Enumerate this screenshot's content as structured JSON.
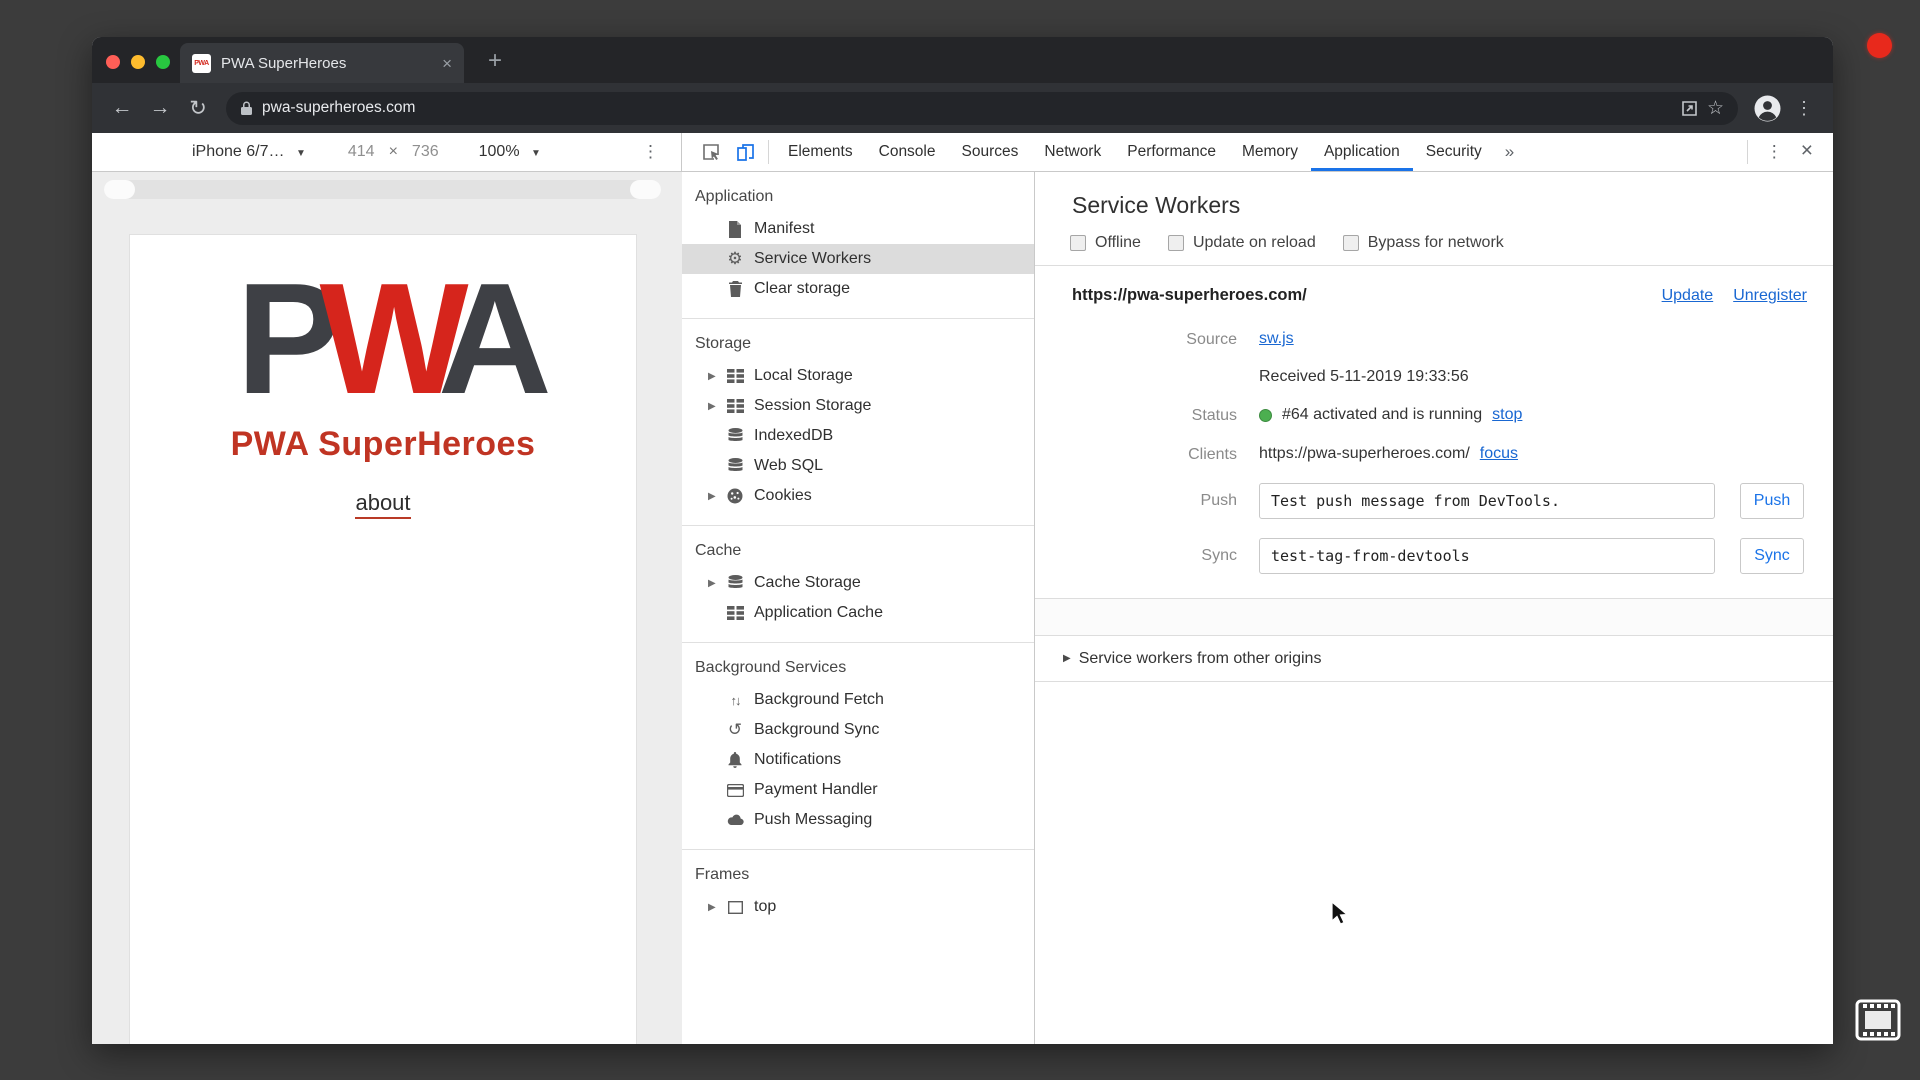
{
  "colors": {
    "accent_blue": "#1a73e8",
    "link_blue": "#1967d2",
    "brand_red": "#d6251c",
    "title_red": "#c03423",
    "status_green": "#4caf50"
  },
  "browser": {
    "tab_title": "PWA SuperHeroes",
    "favicon_text": "PWA",
    "close_tab_glyph": "×",
    "new_tab_glyph": "+",
    "back_glyph": "←",
    "forward_glyph": "→",
    "reload_glyph": "↻",
    "url": "pwa-superheroes.com",
    "star_glyph": "☆",
    "menu_glyph": "⋮"
  },
  "device_toolbar": {
    "device": "iPhone 6/7…",
    "caret": "▼",
    "width": "414",
    "separator": "×",
    "height": "736",
    "zoom": "100%",
    "menu_glyph": "⋮"
  },
  "page": {
    "logo_p": "P",
    "logo_w": "W",
    "logo_a": "A",
    "title": "PWA SuperHeroes",
    "about_link": "about"
  },
  "devtools": {
    "tabs": [
      "Elements",
      "Console",
      "Sources",
      "Network",
      "Performance",
      "Memory",
      "Application",
      "Security"
    ],
    "active_tab": "Application",
    "overflow_glyph": "»",
    "more_glyph": "⋮",
    "close_glyph": "×",
    "sidebar": {
      "sections": [
        {
          "title": "Application",
          "items": [
            {
              "label": "Manifest"
            },
            {
              "label": "Service Workers"
            },
            {
              "label": "Clear storage"
            }
          ]
        },
        {
          "title": "Storage",
          "items": [
            {
              "label": "Local Storage"
            },
            {
              "label": "Session Storage"
            },
            {
              "label": "IndexedDB"
            },
            {
              "label": "Web SQL"
            },
            {
              "label": "Cookies"
            }
          ]
        },
        {
          "title": "Cache",
          "items": [
            {
              "label": "Cache Storage"
            },
            {
              "label": "Application Cache"
            }
          ]
        },
        {
          "title": "Background Services",
          "items": [
            {
              "label": "Background Fetch"
            },
            {
              "label": "Background Sync"
            },
            {
              "label": "Notifications"
            },
            {
              "label": "Payment Handler"
            },
            {
              "label": "Push Messaging"
            }
          ]
        },
        {
          "title": "Frames",
          "items": [
            {
              "label": "top"
            }
          ]
        }
      ]
    },
    "panel": {
      "title": "Service Workers",
      "checkboxes": [
        "Offline",
        "Update on reload",
        "Bypass for network"
      ],
      "origin": "https://pwa-superheroes.com/",
      "update_link": "Update",
      "unregister_link": "Unregister",
      "source_label": "Source",
      "source_value": "sw.js",
      "received": "Received 5-11-2019 19:33:56",
      "status_label": "Status",
      "status_text": "#64 activated and is running",
      "stop_link": "stop",
      "clients_label": "Clients",
      "clients_value": "https://pwa-superheroes.com/",
      "focus_link": "focus",
      "push_label": "Push",
      "push_value": "Test push message from DevTools.",
      "push_button": "Push",
      "sync_label": "Sync",
      "sync_value": "test-tag-from-devtools",
      "sync_button": "Sync",
      "other_origins": "Service workers from other origins",
      "expander_glyph": "▶"
    }
  }
}
